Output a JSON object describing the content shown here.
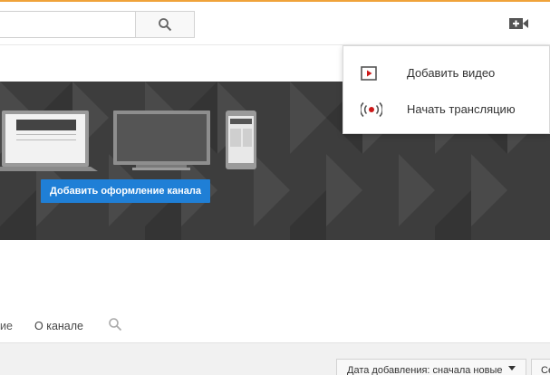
{
  "header": {
    "search": {
      "placeholder": "",
      "value": ""
    },
    "search_button_icon": "search-icon",
    "upload_icon": "video-camera-add-icon",
    "accent_color": "#f0a33a"
  },
  "banner": {
    "add_button_label": "Добавить оформление канала",
    "button_color": "#1f7fd6",
    "devices": [
      "laptop",
      "tv",
      "phone"
    ]
  },
  "tabs": {
    "partial_label": "ие",
    "about_label": "О канале",
    "search_icon": "search-icon"
  },
  "sort": {
    "selected": "Дата добавления: сначала новые",
    "second_button_label": "Се"
  },
  "upload_menu": {
    "items": [
      {
        "label": "Добавить видео",
        "icon": "video-play-icon"
      },
      {
        "label": "Начать трансляцию",
        "icon": "live-broadcast-icon",
        "color": "#cc1818"
      }
    ]
  }
}
